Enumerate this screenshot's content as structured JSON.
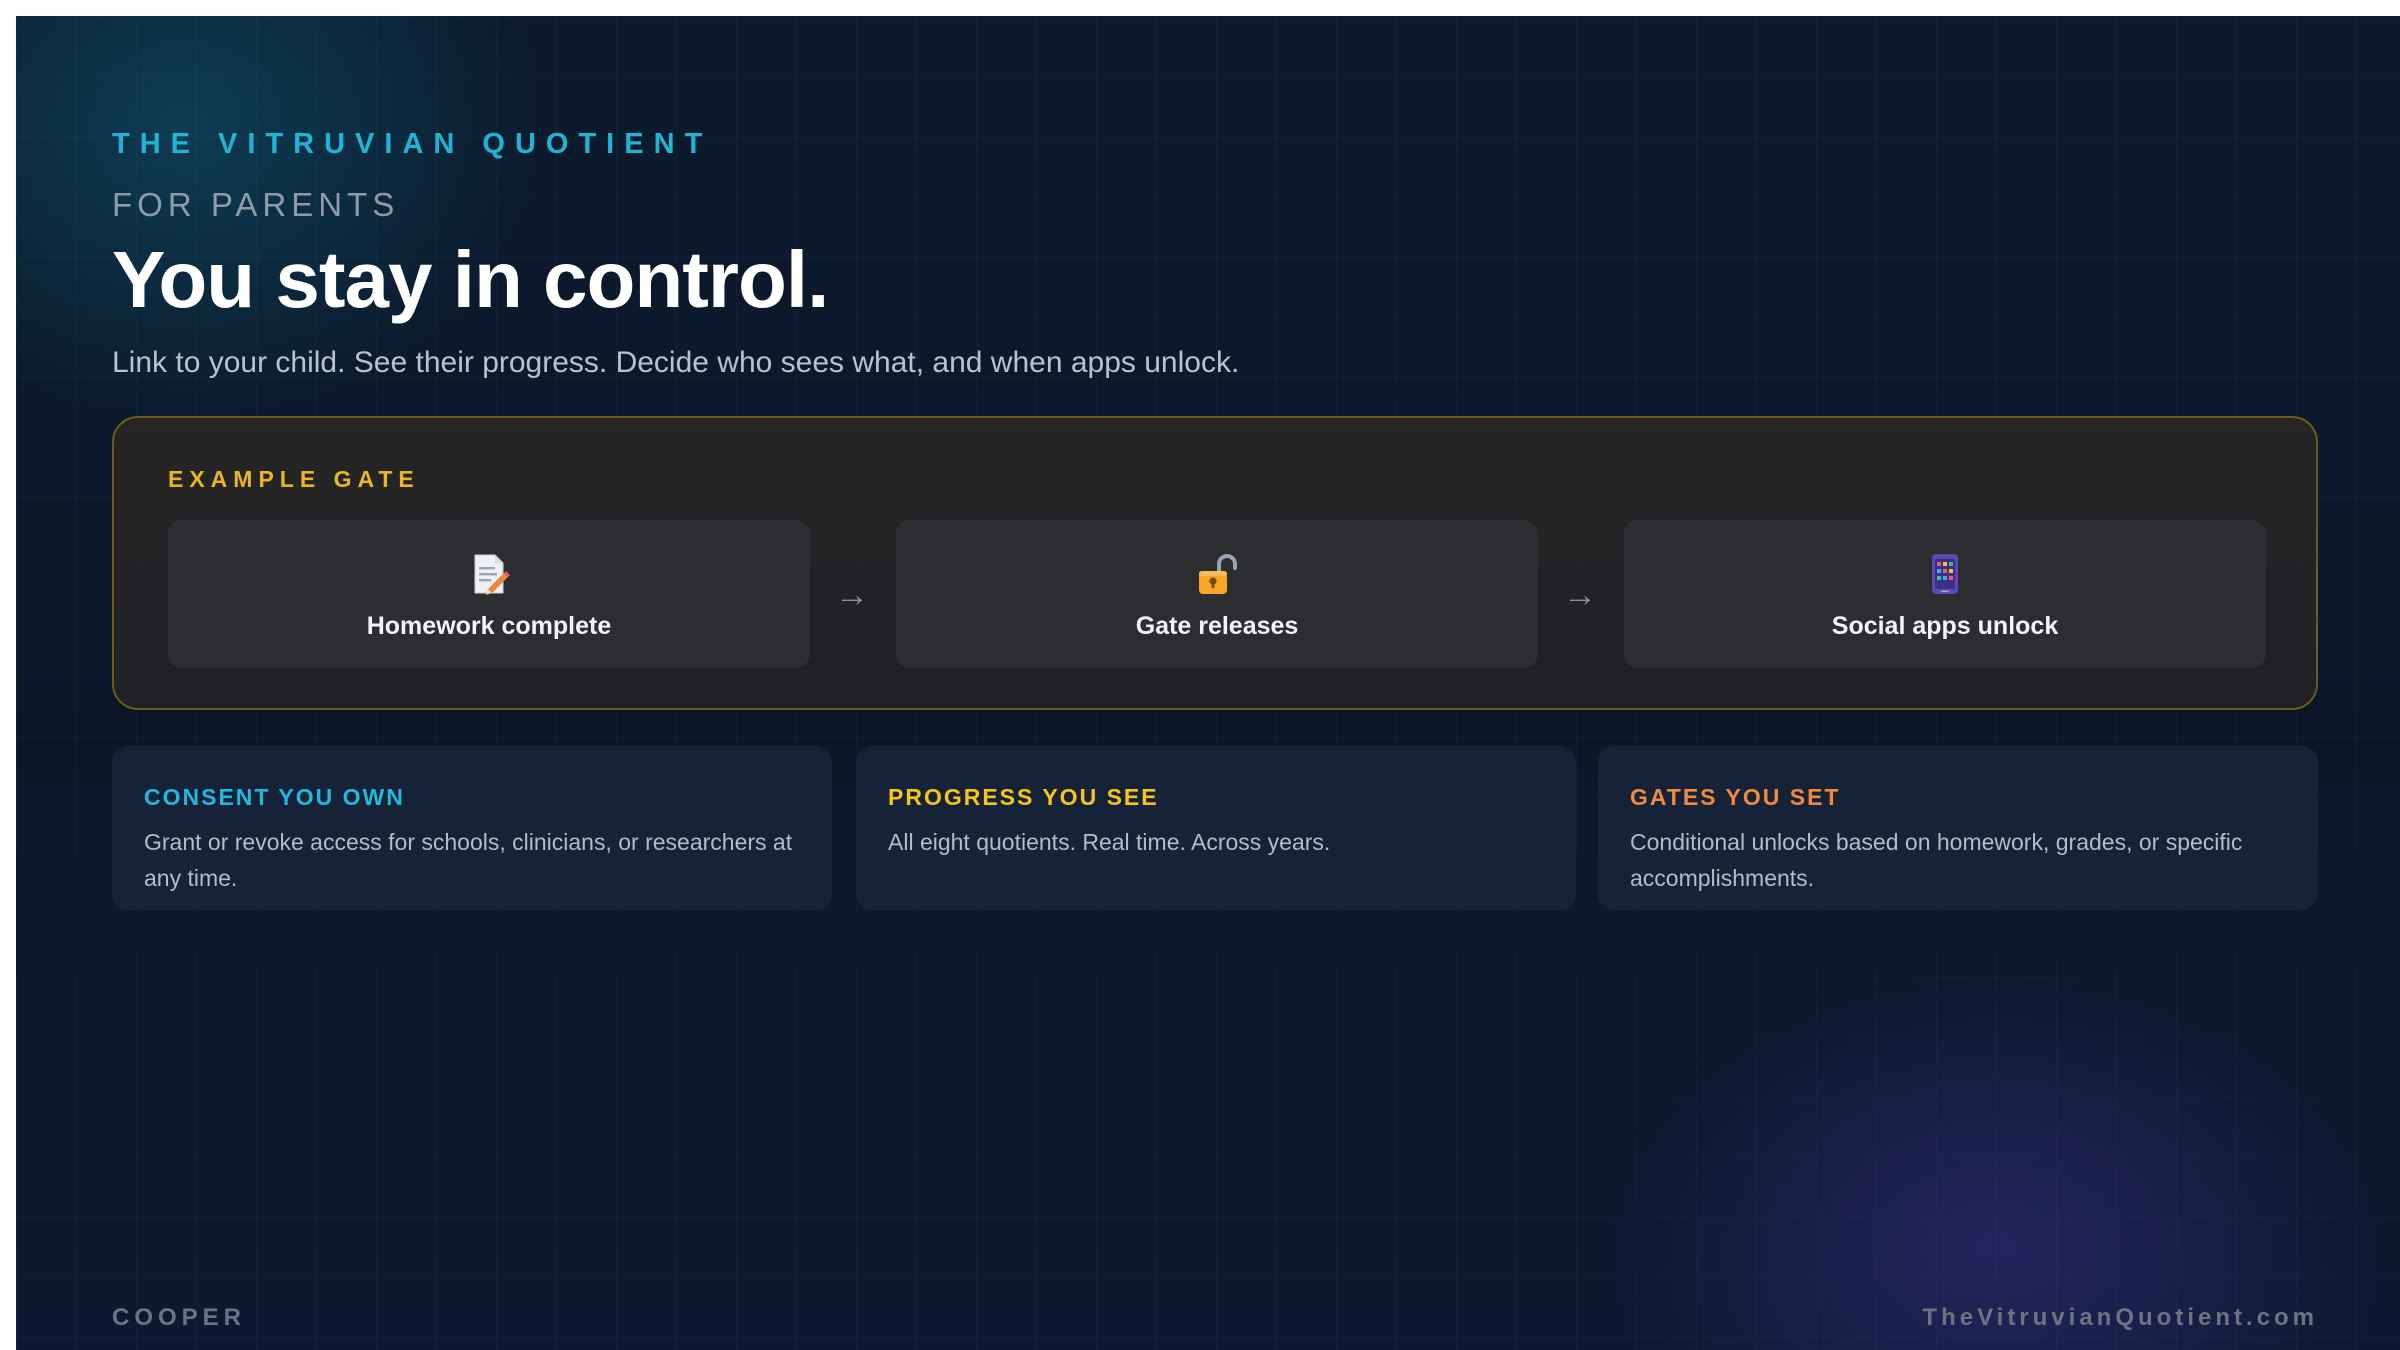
{
  "brand": {
    "eyebrow": "THE VITRUVIAN QUOTIENT",
    "section_label": "FOR PARENTS"
  },
  "hero": {
    "headline": "You stay in control.",
    "subhead": "Link to your child. See their progress. Decide who sees what, and when apps unlock."
  },
  "example_gate": {
    "title": "EXAMPLE GATE",
    "steps": [
      {
        "label": "Homework complete",
        "icon": "memo-pencil-icon"
      },
      {
        "label": "Gate releases",
        "icon": "unlocked-padlock-icon"
      },
      {
        "label": "Social apps unlock",
        "icon": "phone-apps-icon"
      }
    ],
    "arrow_glyph": "→"
  },
  "cards": [
    {
      "title": "CONSENT YOU OWN",
      "body": "Grant or revoke access for schools, clinicians, or researchers at any time.",
      "accent": "#22b8d8"
    },
    {
      "title": "PROGRESS YOU SEE",
      "body": "All eight quotients. Real time. Across years.",
      "accent": "#f5c518"
    },
    {
      "title": "GATES YOU SET",
      "body": "Conditional unlocks based on homework, grades, or specific accomplishments.",
      "accent": "#f08a3c"
    }
  ],
  "footer": {
    "left": "COOPER",
    "right": "TheVitruvianQuotient.com"
  },
  "colors": {
    "background": "#0b1729",
    "eyebrow": "#1fb4d2",
    "gate_accent": "#e8b624",
    "panel_border": "#6b5c1e"
  }
}
